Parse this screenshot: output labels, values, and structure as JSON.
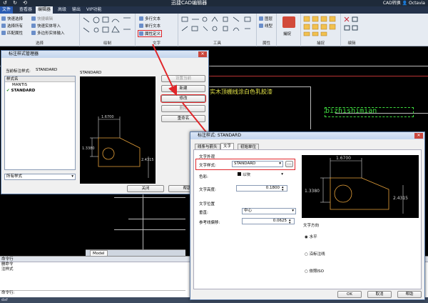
{
  "app": {
    "title": "迅捷CAD编辑器",
    "right": "CAD转换  👤 Octavia",
    "quick_access": "↺ ↻ ⟲"
  },
  "tabs": [
    {
      "label": "文件"
    },
    {
      "label": "查看器"
    },
    {
      "label": "编辑器"
    },
    {
      "label": "高级"
    },
    {
      "label": "输出"
    },
    {
      "label": "VIP功能"
    }
  ],
  "ribbon": {
    "select": {
      "label": "选择",
      "items": [
        "快速选择",
        "选择所有",
        "匹配属性",
        "快捷编辑",
        "快速实体导入",
        "多边形实体输入"
      ]
    },
    "draw": {
      "label": "绘制"
    },
    "text": {
      "label": "文字",
      "items": [
        "多行文本",
        "单行文本",
        "属性定义"
      ]
    },
    "tools": {
      "label": "工具"
    },
    "attr": {
      "label": "属性",
      "items": [
        "图层",
        "线型"
      ]
    },
    "capture": {
      "label": "捕捉",
      "items": [
        "捕捉"
      ]
    },
    "edit": {
      "label": "编辑"
    }
  },
  "cad": {
    "text1": "实木顶棚线涂白色乳胶漆",
    "text2": "bizhishimian",
    "model_tab": "Model"
  },
  "cmd": {
    "head": "命令行",
    "lines": [
      "删命令",
      "注样式"
    ],
    "prompt": "命令行:",
    "status": "dxf"
  },
  "dim_manager": {
    "title": "标注样式管理器",
    "current_label": "当前标注样式:",
    "current_value": "STANDARD",
    "list_header": "样式名",
    "styles": [
      {
        "name": "MANTIS"
      },
      {
        "name": "STANDARD",
        "check": "✔"
      }
    ],
    "preview_label": "STANDARD",
    "filter": "所有样式",
    "buttons": {
      "set_current": "设置当前",
      "new": "新建",
      "modify": "修改",
      "delete": "删除",
      "rename": "重命名",
      "close": "关闭",
      "help": "帮助"
    }
  },
  "dim_edit": {
    "title": "标注样式: STANDARD",
    "tabs": [
      "线条与箭头",
      "文字",
      "初始单位"
    ],
    "appearance": "文字外观",
    "style_label": "文字样式:",
    "style_value": "STANDARD",
    "color_label": "色彩:",
    "color_value": "以块",
    "height_label": "文字高度:",
    "height_value": "0.1800",
    "position": "文字位置",
    "vertical_label": "垂直:",
    "vertical_value": "中心",
    "offset_label": "参考线偏移:",
    "offset_value": "0.0625",
    "direction": "文字方向",
    "dir_options": [
      "水平",
      "沿标注线",
      "依照ISO"
    ],
    "ok": "OK",
    "cancel": "取消",
    "help": "帮助"
  },
  "preview": {
    "d1": "1.6700",
    "d2": "1.3380",
    "d3": "2.4315"
  },
  "colors": {
    "dim": "#d8d8d8",
    "shape": "#e8a23a",
    "highlight": "#e0262a"
  }
}
